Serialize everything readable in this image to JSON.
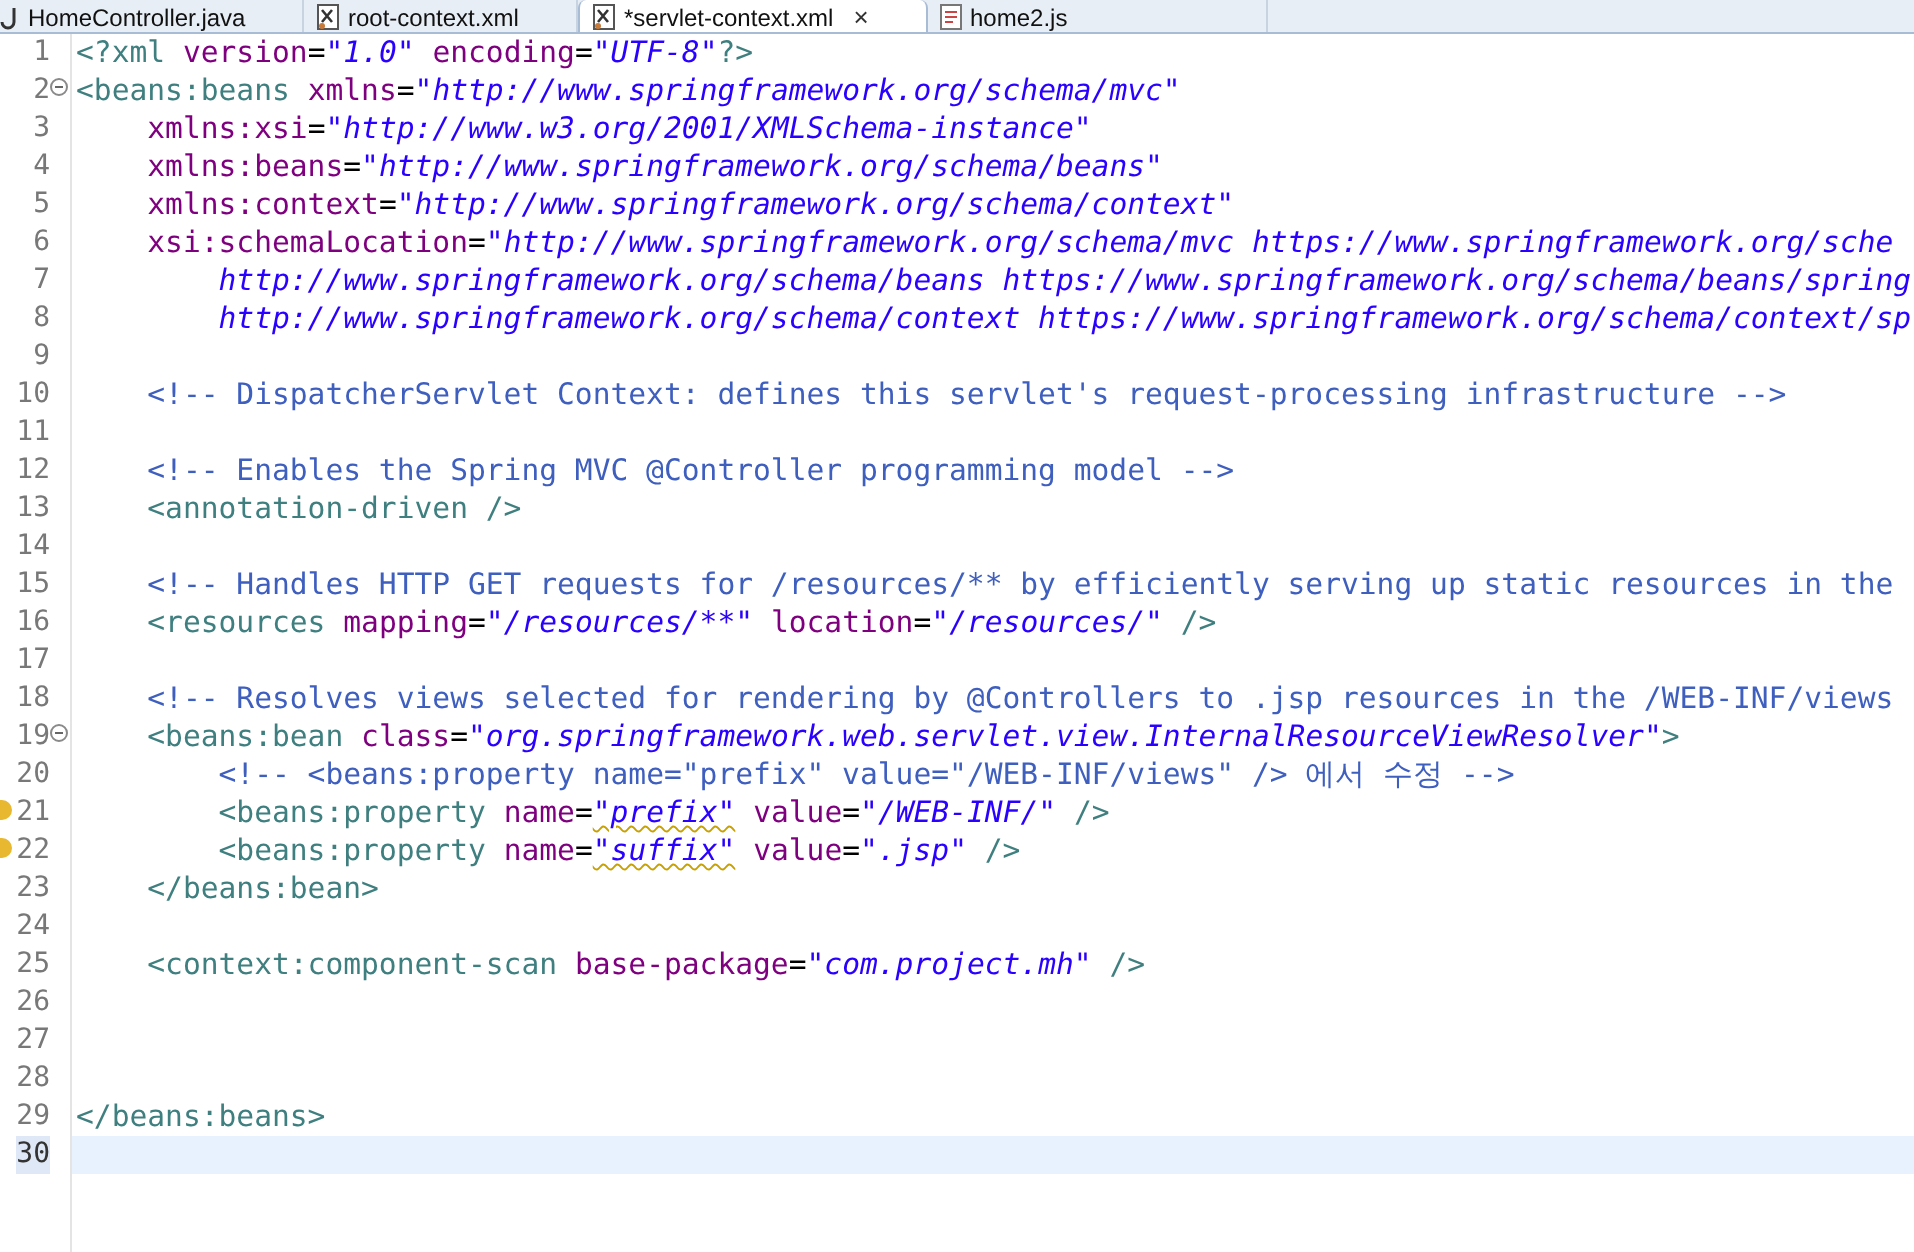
{
  "tabs": [
    {
      "label": "HomeController.java",
      "kind": "java",
      "selected": false
    },
    {
      "label": "root-context.xml",
      "kind": "xml",
      "selected": false
    },
    {
      "label": "*servlet-context.xml",
      "kind": "xml",
      "selected": true,
      "close": "×"
    },
    {
      "label": "home2.js",
      "kind": "js",
      "selected": false
    }
  ],
  "editor": {
    "lines": [
      {
        "number": "1",
        "fold": false,
        "warning": false,
        "current": false,
        "tokens": [
          {
            "kind": "tag",
            "text": "<?xml"
          },
          {
            "kind": "attr",
            "text": "version"
          },
          {
            "kind": "eq",
            "text": "="
          },
          {
            "kind": "str",
            "text": "\"1.0\""
          },
          {
            "kind": "attr",
            "text": "encoding"
          },
          {
            "kind": "eq",
            "text": "="
          },
          {
            "kind": "str",
            "text": "\"UTF-8\""
          },
          {
            "kind": "tag",
            "text": "?>"
          }
        ]
      },
      {
        "number": "2",
        "fold": true,
        "warning": false,
        "current": false,
        "tokens": [
          {
            "kind": "tag",
            "text": "<beans:beans"
          },
          {
            "kind": "attr",
            "text": "xmlns"
          },
          {
            "kind": "eq",
            "text": "="
          },
          {
            "kind": "str",
            "text": "\"http://www.springframework.org/schema/mvc\""
          }
        ],
        "children": [
          {
            "number": "3",
            "fold": false,
            "warning": false,
            "current": false,
            "tokens": [
              {
                "kind": "name",
                "text": "xmlns:xsi"
              },
              {
                "kind": "eq",
                "text": "="
              },
              {
                "kind": "str",
                "text": "\"http://www.w3.org/2001/XMLSchema-instance\""
              }
            ]
          },
          {
            "number": "4",
            "fold": false,
            "warning": false,
            "current": false,
            "tokens": [
              {
                "kind": "name",
                "text": "xmlns:beans"
              },
              {
                "kind": "eq",
                "text": "="
              },
              {
                "kind": "str",
                "text": "\"http://www.springframework.org/schema/beans\""
              }
            ]
          },
          {
            "number": "5",
            "fold": false,
            "warning": false,
            "current": false,
            "tokens": [
              {
                "kind": "name",
                "text": "xmlns:context"
              },
              {
                "kind": "eq",
                "text": "="
              },
              {
                "kind": "str",
                "text": "\"http://www.springframework.org/schema/context\""
              }
            ]
          },
          {
            "number": "6",
            "fold": false,
            "warning": false,
            "current": false,
            "tokens": [
              {
                "kind": "name",
                "text": "xsi:schemaLocation"
              },
              {
                "kind": "eq",
                "text": "="
              },
              {
                "kind": "str",
                "text": "\"http://www.springframework.org/schema/mvc https://www.springframework.org/sche"
              }
            ],
            "children": [
              {
                "number": "7",
                "fold": false,
                "warning": false,
                "current": false,
                "tokens": [
                  {
                    "kind": "str",
                    "text": "http://www.springframework.org/schema/beans https://www.springframework.org/schema/beans/spring"
                  }
                ]
              },
              {
                "number": "8",
                "fold": false,
                "warning": false,
                "current": false,
                "tokens": [
                  {
                    "kind": "str",
                    "text": "http://www.springframework.org/schema/context https://www.springframework.org/schema/context/sp"
                  }
                ]
              }
            ]
          },
          {
            "number": "9",
            "fold": false,
            "warning": false,
            "current": false
          },
          {
            "number": "10",
            "fold": false,
            "warning": false,
            "current": false,
            "tokens": [
              {
                "kind": "comment",
                "text": "<!-- DispatcherServlet Context: defines this servlet's request-processing infrastructure -->"
              }
            ]
          },
          {
            "number": "11",
            "fold": false,
            "warning": false,
            "current": false
          },
          {
            "number": "12",
            "fold": false,
            "warning": false,
            "current": false,
            "tokens": [
              {
                "kind": "comment",
                "text": "<!-- Enables the Spring MVC @Controller programming model -->"
              }
            ]
          },
          {
            "number": "13",
            "fold": false,
            "warning": false,
            "current": false,
            "tokens": [
              {
                "kind": "tag",
                "text": "<annotation-driven"
              },
              {
                "kind": "close",
                "text": "/>"
              }
            ]
          },
          {
            "number": "14",
            "fold": false,
            "warning": false,
            "current": false
          },
          {
            "number": "15",
            "fold": false,
            "warning": false,
            "current": false,
            "tokens": [
              {
                "kind": "comment",
                "text": "<!-- Handles HTTP GET requests for /resources/** by efficiently serving up static resources in the"
              }
            ]
          },
          {
            "number": "16",
            "fold": false,
            "warning": false,
            "current": false,
            "tokens": [
              {
                "kind": "tag",
                "text": "<resources"
              },
              {
                "kind": "attr",
                "text": "mapping"
              },
              {
                "kind": "eq",
                "text": "="
              },
              {
                "kind": "str",
                "text": "\"/resources/**\""
              },
              {
                "kind": "attr",
                "text": "location"
              },
              {
                "kind": "eq",
                "text": "="
              },
              {
                "kind": "str",
                "text": "\"/resources/\""
              },
              {
                "kind": "close",
                "text": "/>"
              }
            ]
          },
          {
            "number": "17",
            "fold": false,
            "warning": false,
            "current": false
          },
          {
            "number": "18",
            "fold": false,
            "warning": false,
            "current": false,
            "tokens": [
              {
                "kind": "comment",
                "text": "<!-- Resolves views selected for rendering by @Controllers to .jsp resources in the /WEB-INF/views"
              }
            ]
          },
          {
            "number": "19",
            "fold": true,
            "warning": false,
            "current": false,
            "tokens": [
              {
                "kind": "tag",
                "text": "<beans:bean"
              },
              {
                "kind": "attr",
                "text": "class"
              },
              {
                "kind": "eq",
                "text": "="
              },
              {
                "kind": "str",
                "text": "\"org.springframework.web.servlet.view.InternalResourceViewResolver\""
              },
              {
                "kind": "tag",
                "text": ">"
              }
            ],
            "children": [
              {
                "number": "20",
                "fold": false,
                "warning": false,
                "current": false,
                "tokens": [
                  {
                    "kind": "comment",
                    "text": "<!-- <beans:property name=\"prefix\" value=\"/WEB-INF/views\" /> 에서 수정 -->"
                  }
                ]
              },
              {
                "number": "21",
                "fold": false,
                "warning": true,
                "current": false,
                "tokens": [
                  {
                    "kind": "tag",
                    "text": "<beans:property"
                  },
                  {
                    "kind": "attr",
                    "text": "name"
                  },
                  {
                    "kind": "eq",
                    "text": "="
                  },
                  {
                    "kind": "flagged",
                    "text": "\"prefix\""
                  },
                  {
                    "kind": "attr",
                    "text": "value"
                  },
                  {
                    "kind": "eq",
                    "text": "="
                  },
                  {
                    "kind": "str",
                    "text": "\"/WEB-INF/\""
                  },
                  {
                    "kind": "close",
                    "text": "/>"
                  }
                ]
              },
              {
                "number": "22",
                "fold": false,
                "warning": true,
                "current": false,
                "tokens": [
                  {
                    "kind": "tag",
                    "text": "<beans:property"
                  },
                  {
                    "kind": "attr",
                    "text": "name"
                  },
                  {
                    "kind": "eq",
                    "text": "="
                  },
                  {
                    "kind": "flagged",
                    "text": "\"suffix\""
                  },
                  {
                    "kind": "attr",
                    "text": "value"
                  },
                  {
                    "kind": "eq",
                    "text": "="
                  },
                  {
                    "kind": "str",
                    "text": "\".jsp\""
                  },
                  {
                    "kind": "close",
                    "text": "/>"
                  }
                ]
              }
            ]
          },
          {
            "number": "23",
            "fold": false,
            "warning": false,
            "current": false,
            "tokens": [
              {
                "kind": "tag",
                "text": "</beans:bean>"
              }
            ]
          },
          {
            "number": "24",
            "fold": false,
            "warning": false,
            "current": false
          },
          {
            "number": "25",
            "fold": false,
            "warning": false,
            "current": false,
            "tokens": [
              {
                "kind": "tag",
                "text": "<context:component-scan"
              },
              {
                "kind": "attr",
                "text": "base-package"
              },
              {
                "kind": "eq",
                "text": "="
              },
              {
                "kind": "str",
                "text": "\"com.project.mh\""
              },
              {
                "kind": "close",
                "text": "/>"
              }
            ]
          },
          {
            "number": "26",
            "fold": false,
            "warning": false,
            "current": false
          },
          {
            "number": "27",
            "fold": false,
            "warning": false,
            "current": false
          },
          {
            "number": "28",
            "fold": false,
            "warning": false,
            "current": false
          }
        ]
      },
      {
        "number": "29",
        "fold": false,
        "warning": false,
        "current": false,
        "tokens": [
          {
            "kind": "tag",
            "text": "</beans:beans>"
          }
        ]
      },
      {
        "number": "30",
        "fold": false,
        "warning": false,
        "current": true
      }
    ]
  }
}
